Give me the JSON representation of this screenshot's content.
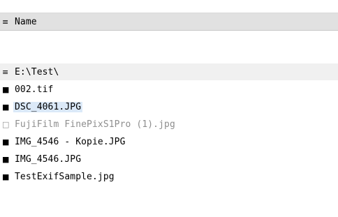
{
  "header": {
    "icon": "list-icon",
    "label": "Name",
    "glyph": "≡"
  },
  "group": {
    "icon": "list-icon",
    "label": "E:\\Test\\",
    "glyph": "≡"
  },
  "files": [
    {
      "name": "002.tif",
      "glyph": "■",
      "icon": "checked-square-icon",
      "selected": false,
      "dimmed": false
    },
    {
      "name": "DSC_4061.JPG",
      "glyph": "■",
      "icon": "checked-square-icon",
      "selected": true,
      "dimmed": false
    },
    {
      "name": "FujiFilm FinePixS1Pro (1).jpg",
      "glyph": "□",
      "icon": "empty-square-icon",
      "selected": false,
      "dimmed": true
    },
    {
      "name": "IMG_4546 - Kopie.JPG",
      "glyph": "■",
      "icon": "checked-square-icon",
      "selected": false,
      "dimmed": false
    },
    {
      "name": "IMG_4546.JPG",
      "glyph": "■",
      "icon": "checked-square-icon",
      "selected": false,
      "dimmed": false
    },
    {
      "name": "TestExifSample.jpg",
      "glyph": "■",
      "icon": "checked-square-icon",
      "selected": false,
      "dimmed": false
    }
  ]
}
